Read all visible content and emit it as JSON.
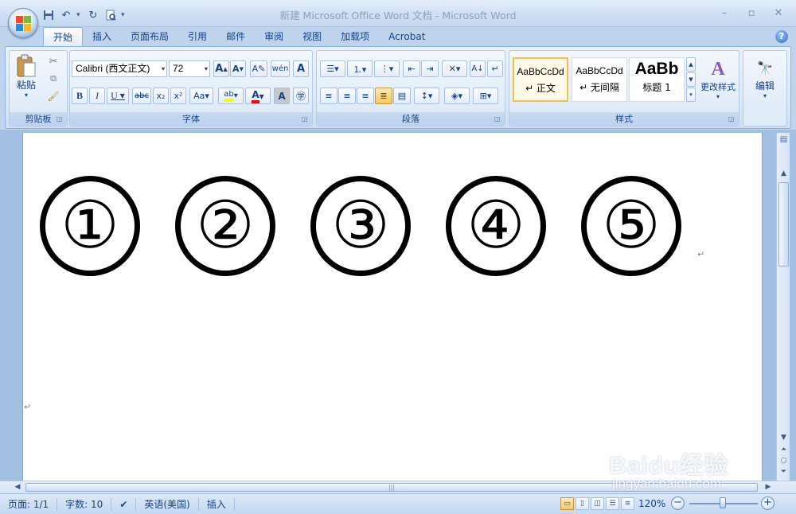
{
  "window": {
    "title": "新建 Microsoft Office Word 文档 - Microsoft Word",
    "controls": [
      "minimize-icon",
      "restore-icon",
      "close-icon"
    ]
  },
  "quick_access": [
    "save-icon",
    "undo-icon",
    "redo-icon",
    "print-preview-icon"
  ],
  "tabs": [
    {
      "label": "开始",
      "active": true
    },
    {
      "label": "插入"
    },
    {
      "label": "页面布局"
    },
    {
      "label": "引用"
    },
    {
      "label": "邮件"
    },
    {
      "label": "审阅"
    },
    {
      "label": "视图"
    },
    {
      "label": "加载项"
    },
    {
      "label": "Acrobat"
    }
  ],
  "ribbon": {
    "clipboard": {
      "label": "剪贴板",
      "paste": "粘贴"
    },
    "font": {
      "label": "字体",
      "font_name": "Calibri (西文正文)",
      "font_size": "72"
    },
    "paragraph": {
      "label": "段落"
    },
    "styles": {
      "label": "样式",
      "items": [
        {
          "sample": "AaBbCcDd",
          "name": "↵ 正文",
          "selected": true
        },
        {
          "sample": "AaBbCcDd",
          "name": "↵ 无间隔"
        },
        {
          "sample": "AaBb",
          "name": "标题 1"
        }
      ],
      "change_styles": "更改样式"
    },
    "editing": {
      "label": "编辑"
    }
  },
  "document": {
    "circled_numbers": [
      "①",
      "②",
      "③",
      "④",
      "⑤"
    ],
    "paragraph_mark": "↵"
  },
  "status": {
    "page": "页面: 1/1",
    "words": "字数: 10",
    "language": "英语(美国)",
    "mode": "插入",
    "zoom": "120%",
    "zoom_level": 1.2
  },
  "watermark": {
    "main": "Baidu经验",
    "sub": "jingyan.baidu.com"
  },
  "colors": {
    "accent": "#15428b",
    "ribbon_bg": "#dbe8f7",
    "highlight_yellow": "#ffff00",
    "font_color_red": "#ff0000"
  }
}
